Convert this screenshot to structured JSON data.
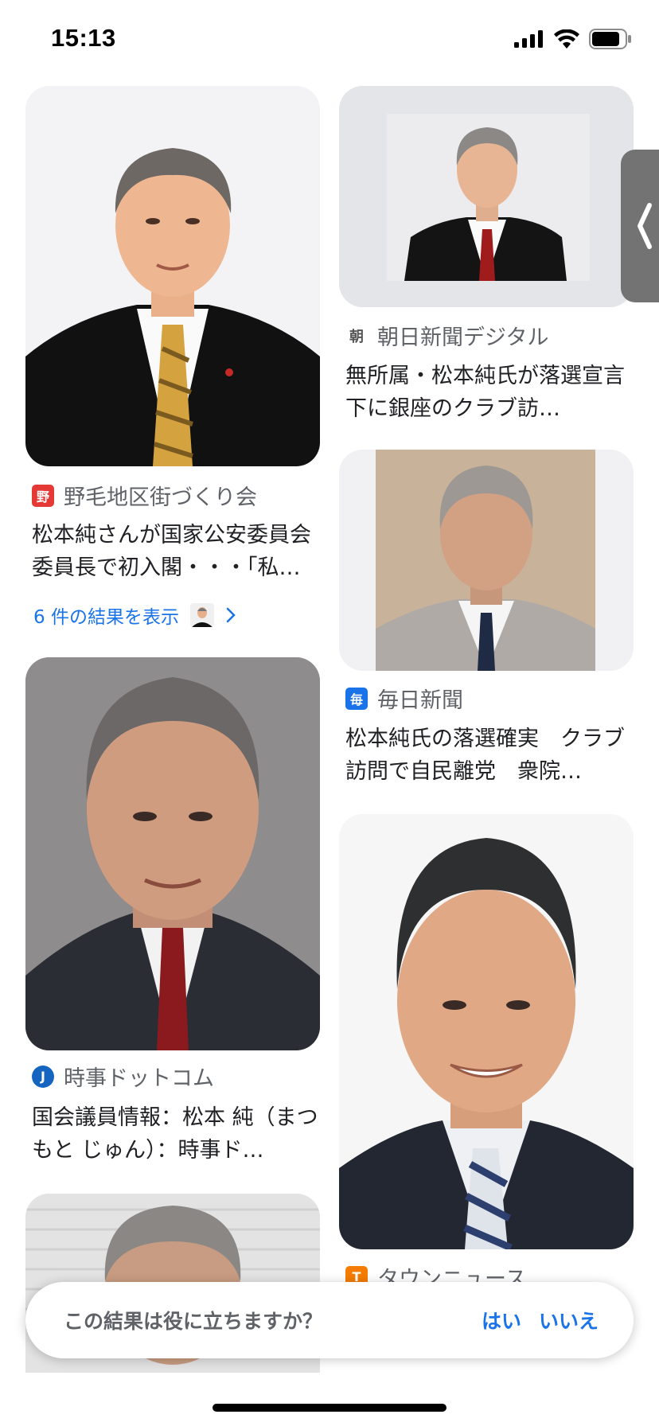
{
  "status_bar": {
    "time": "15:13"
  },
  "results": {
    "left": [
      {
        "source": "野毛地区街づくり会",
        "source_icon_text": "野",
        "source_color": "#e53935",
        "title": "松本純さんが国家公安委員会委員長で初入閣・・・「私…",
        "more_label": "6 件の結果を表示"
      },
      {
        "source": "時事ドットコム",
        "source_icon_text": "J",
        "source_color": "#1565c0",
        "title": "国会議員情報：松本 純（まつもと じゅん）：時事ド…"
      },
      {
        "image_only": true
      }
    ],
    "right": [
      {
        "source": "朝日新聞デジタル",
        "source_icon_text": "朝",
        "source_color": "#9e9e9e",
        "title": "無所属・松本純氏が落選宣言下に銀座のクラブ訪…"
      },
      {
        "source": "毎日新聞",
        "source_icon_text": "毎",
        "source_color": "#1a73e8",
        "title": "松本純氏の落選確実　クラブ訪問で自民離党　衆院…"
      },
      {
        "source": "タウンニュース",
        "source_icon_text": "T",
        "source_color": "#f57c00"
      }
    ]
  },
  "feedback": {
    "question": "この結果は役に立ちますか？",
    "yes": "はい",
    "no": "いいえ"
  },
  "colors": {
    "link": "#1a73e8",
    "secondary_text": "#5f6368"
  },
  "icons": [
    "signal-icon",
    "wifi-icon",
    "battery-icon",
    "chevron-right-icon",
    "chevron-left-icon"
  ]
}
